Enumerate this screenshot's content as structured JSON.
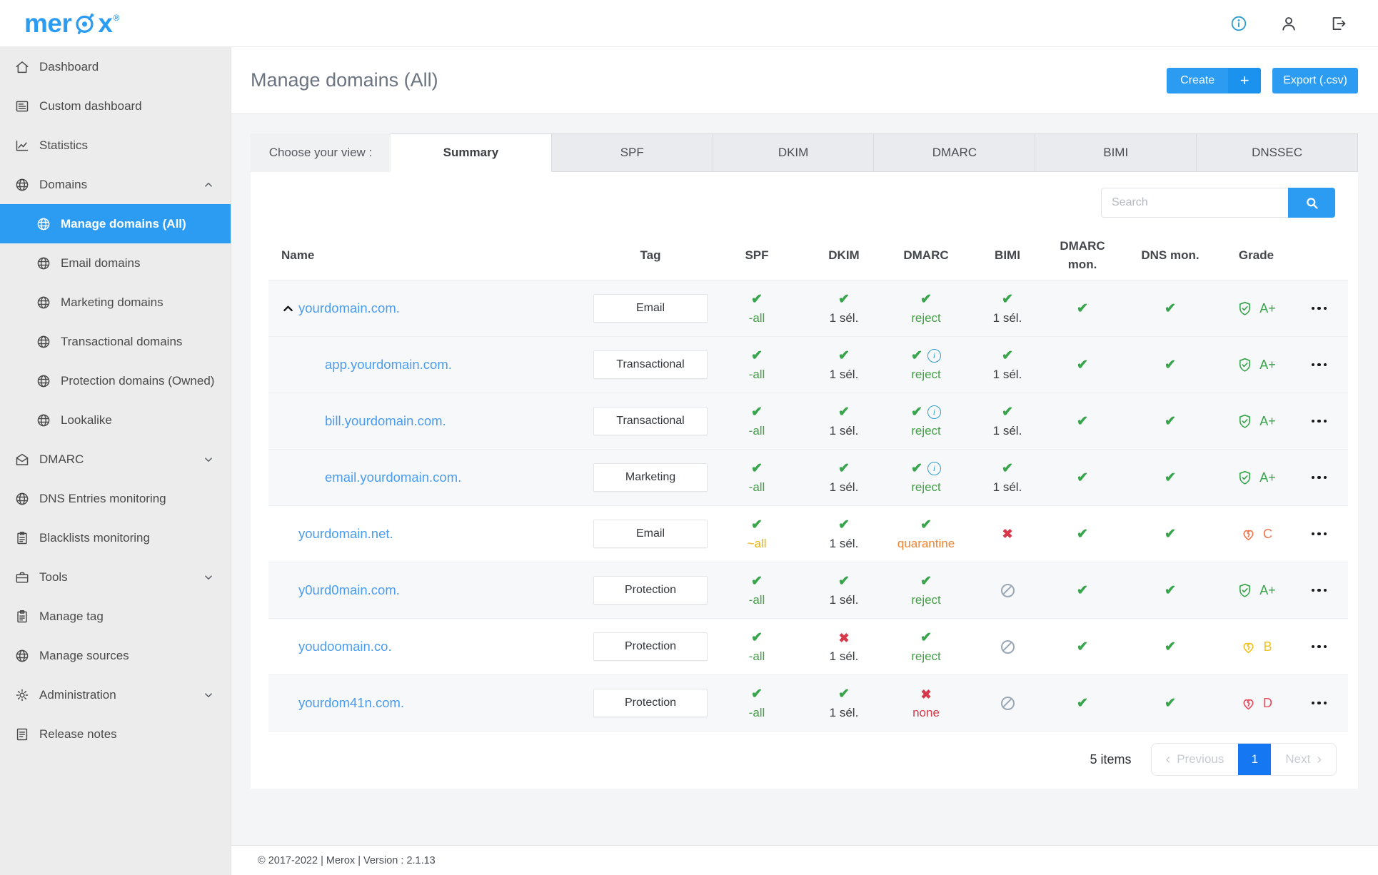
{
  "brand": {
    "logo_pre": "mer",
    "logo_post": "x",
    "trademark": "®"
  },
  "sidebar": {
    "items": [
      {
        "label": "Dashboard",
        "icon": "home-icon"
      },
      {
        "label": "Custom dashboard",
        "icon": "custom-dashboard-icon"
      },
      {
        "label": "Statistics",
        "icon": "statistics-icon"
      },
      {
        "label": "Domains",
        "icon": "globe-icon",
        "chevron": "up"
      },
      {
        "label": "Manage domains (All)",
        "icon": "globe-icon",
        "child": true,
        "selected": true
      },
      {
        "label": "Email domains",
        "icon": "globe-icon",
        "child": true
      },
      {
        "label": "Marketing domains",
        "icon": "globe-icon",
        "child": true
      },
      {
        "label": "Transactional domains",
        "icon": "globe-icon",
        "child": true
      },
      {
        "label": "Protection domains (Owned)",
        "icon": "globe-icon",
        "child": true
      },
      {
        "label": "Lookalike",
        "icon": "globe-icon",
        "child": true
      },
      {
        "label": "DMARC",
        "icon": "mail-icon",
        "chevron": "down"
      },
      {
        "label": "DNS Entries monitoring",
        "icon": "globe-icon"
      },
      {
        "label": "Blacklists monitoring",
        "icon": "clipboard-icon"
      },
      {
        "label": "Tools",
        "icon": "briefcase-icon",
        "chevron": "down"
      },
      {
        "label": "Manage tag",
        "icon": "clipboard-icon"
      },
      {
        "label": "Manage sources",
        "icon": "globe-icon"
      },
      {
        "label": "Administration",
        "icon": "gear-icon",
        "chevron": "down"
      },
      {
        "label": "Release notes",
        "icon": "notes-icon"
      }
    ]
  },
  "page": {
    "title": "Manage domains (All)",
    "create_label": "Create",
    "create_plus": "+",
    "export_label": "Export (.csv)"
  },
  "tabs": {
    "label": "Choose your view :",
    "active": "Summary",
    "items": [
      "Summary",
      "SPF",
      "DKIM",
      "DMARC",
      "BIMI",
      "DNSSEC"
    ]
  },
  "search": {
    "placeholder": "Search"
  },
  "table": {
    "columns": [
      "Name",
      "Tag",
      "SPF",
      "DKIM",
      "DMARC",
      "BIMI",
      "DMARC mon.",
      "DNS mon.",
      "Grade",
      ""
    ],
    "rows": [
      {
        "name": "yourdomain.com.",
        "expander": true,
        "child": false,
        "stripe": "g",
        "tag": "Email",
        "spf": {
          "status": "check",
          "text": "-all",
          "tone": "green"
        },
        "dkim": {
          "status": "check",
          "text": "1 sél.",
          "tone": "dark"
        },
        "dmarc": {
          "status": "check",
          "text": "reject",
          "tone": "green"
        },
        "bimi": {
          "status": "check",
          "text": "1 sél.",
          "tone": "dark"
        },
        "dmarc_mon": {
          "status": "check"
        },
        "dns_mon": {
          "status": "check"
        },
        "grade": {
          "icon": "shield",
          "label": "A+",
          "tone": "green"
        }
      },
      {
        "name": "app.yourdomain.com.",
        "expander": false,
        "child": true,
        "stripe": "g",
        "tag": "Transactional",
        "spf": {
          "status": "check",
          "text": "-all",
          "tone": "green"
        },
        "dkim": {
          "status": "check",
          "text": "1 sél.",
          "tone": "dark"
        },
        "dmarc": {
          "status": "check",
          "text": "reject",
          "tone": "green",
          "info": true
        },
        "bimi": {
          "status": "check",
          "text": "1 sél.",
          "tone": "dark"
        },
        "dmarc_mon": {
          "status": "check"
        },
        "dns_mon": {
          "status": "check"
        },
        "grade": {
          "icon": "shield",
          "label": "A+",
          "tone": "green"
        }
      },
      {
        "name": "bill.yourdomain.com.",
        "expander": false,
        "child": true,
        "stripe": "g",
        "tag": "Transactional",
        "spf": {
          "status": "check",
          "text": "-all",
          "tone": "green"
        },
        "dkim": {
          "status": "check",
          "text": "1 sél.",
          "tone": "dark"
        },
        "dmarc": {
          "status": "check",
          "text": "reject",
          "tone": "green",
          "info": true
        },
        "bimi": {
          "status": "check",
          "text": "1 sél.",
          "tone": "dark"
        },
        "dmarc_mon": {
          "status": "check"
        },
        "dns_mon": {
          "status": "check"
        },
        "grade": {
          "icon": "shield",
          "label": "A+",
          "tone": "green"
        }
      },
      {
        "name": "email.yourdomain.com.",
        "expander": false,
        "child": true,
        "stripe": "g",
        "tag": "Marketing",
        "spf": {
          "status": "check",
          "text": "-all",
          "tone": "green"
        },
        "dkim": {
          "status": "check",
          "text": "1 sél.",
          "tone": "dark"
        },
        "dmarc": {
          "status": "check",
          "text": "reject",
          "tone": "green",
          "info": true
        },
        "bimi": {
          "status": "check",
          "text": "1 sél.",
          "tone": "dark"
        },
        "dmarc_mon": {
          "status": "check"
        },
        "dns_mon": {
          "status": "check"
        },
        "grade": {
          "icon": "shield",
          "label": "A+",
          "tone": "green"
        }
      },
      {
        "name": "yourdomain.net.",
        "expander": false,
        "child": false,
        "stripe": "w",
        "tag": "Email",
        "spf": {
          "status": "check",
          "text": "~all",
          "tone": "gold"
        },
        "dkim": {
          "status": "check",
          "text": "1 sél.",
          "tone": "dark"
        },
        "dmarc": {
          "status": "check",
          "text": "quarantine",
          "tone": "orange"
        },
        "bimi": {
          "status": "cross"
        },
        "dmarc_mon": {
          "status": "check"
        },
        "dns_mon": {
          "status": "check"
        },
        "grade": {
          "icon": "heart",
          "label": "C",
          "tone": "orange"
        }
      },
      {
        "name": "y0urd0main.com.",
        "expander": false,
        "child": false,
        "stripe": "g",
        "tag": "Protection",
        "spf": {
          "status": "check",
          "text": "-all",
          "tone": "green"
        },
        "dkim": {
          "status": "check",
          "text": "1 sél.",
          "tone": "dark"
        },
        "dmarc": {
          "status": "check",
          "text": "reject",
          "tone": "green"
        },
        "bimi": {
          "status": "blocked"
        },
        "dmarc_mon": {
          "status": "check"
        },
        "dns_mon": {
          "status": "check"
        },
        "grade": {
          "icon": "shield",
          "label": "A+",
          "tone": "green"
        }
      },
      {
        "name": "youdoomain.co.",
        "expander": false,
        "child": false,
        "stripe": "w",
        "tag": "Protection",
        "spf": {
          "status": "check",
          "text": "-all",
          "tone": "green"
        },
        "dkim": {
          "status": "cross",
          "text": "1 sél.",
          "tone": "dark"
        },
        "dmarc": {
          "status": "check",
          "text": "reject",
          "tone": "green"
        },
        "bimi": {
          "status": "blocked"
        },
        "dmarc_mon": {
          "status": "check"
        },
        "dns_mon": {
          "status": "check"
        },
        "grade": {
          "icon": "heart",
          "label": "B",
          "tone": "gold"
        }
      },
      {
        "name": "yourdom41n.com.",
        "expander": false,
        "child": false,
        "stripe": "g",
        "tag": "Protection",
        "spf": {
          "status": "check",
          "text": "-all",
          "tone": "green"
        },
        "dkim": {
          "status": "check",
          "text": "1 sél.",
          "tone": "dark"
        },
        "dmarc": {
          "status": "cross",
          "text": "none",
          "tone": "red"
        },
        "bimi": {
          "status": "blocked"
        },
        "dmarc_mon": {
          "status": "check"
        },
        "dns_mon": {
          "status": "check"
        },
        "grade": {
          "icon": "heart",
          "label": "D",
          "tone": "red"
        }
      }
    ]
  },
  "pagination": {
    "count": "5 items",
    "prev_arrow": "‹",
    "prev": "Previous",
    "current": "1",
    "next": "Next",
    "next_arrow": "›"
  },
  "footer": {
    "text": "© 2017-2022 | Merox | Version : 2.1.13"
  },
  "colors": {
    "accent": "#2b9cf2",
    "accent2": "#1b93ee",
    "link": "#4a9cf0",
    "green": "#38a44b",
    "text_green": "#43a047",
    "gold": "#efb100",
    "orange": "#ee8434",
    "red": "#d6394a",
    "grade_orange": "#f0764e",
    "grade_gold": "#f2c11c",
    "grade_red": "#e84b5c",
    "blocked": "#9aa7b5",
    "info": "#2f9ccc",
    "pager_active": "#1577f2"
  }
}
